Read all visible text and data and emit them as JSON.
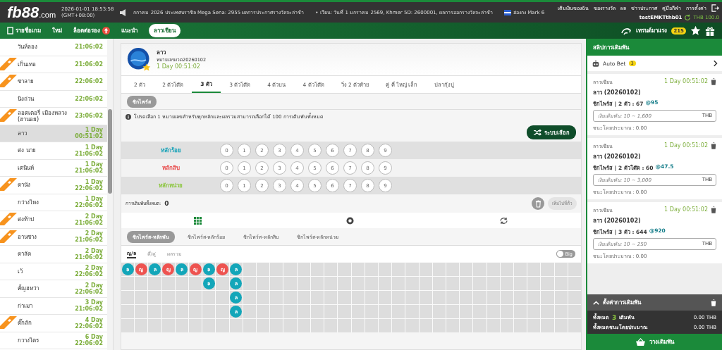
{
  "header": {
    "logo_main": "fb88",
    "logo_suffix": ".com",
    "datetime": "2026-01-01 18:53:58",
    "timezone": "(GMT+08:00)",
    "ticker": [
      "กกาคม 2026 ประเทศบราซิล Mega Sena: 2955 ผลการประกาศรางวัลจะล่าช้า",
      "• เวียน: วันที่ 1 มกราคม 2569, Khmer 5D: 2600001, ผลการออกรางวัลจะล่าช้า",
      "ฮ่องกง Mark 6"
    ],
    "links": [
      "เติมเงินของฉัน",
      "ของรางวัล",
      "ผล",
      "ข่าวประกาศ",
      "คู่มือกีฬา",
      "การตั้งค่า"
    ],
    "username": "testEMKTthb01",
    "balance": "THB 100.0"
  },
  "nav": {
    "items": [
      {
        "label": "รายชื่อเกม",
        "selected": false,
        "kind": "list"
      },
      {
        "label": "ใหม่",
        "selected": false,
        "kind": "plain"
      },
      {
        "label": "ล็อตต่อรอง",
        "selected": false,
        "kind": "hot"
      },
      {
        "label": "แนะนำ",
        "selected": false,
        "kind": "plain"
      },
      {
        "label": "ลาวเชียน",
        "selected": true,
        "kind": "plain"
      }
    ],
    "trending": "เทรนด์มาแรง",
    "trending_count": "215"
  },
  "sidebar": {
    "items": [
      {
        "name": "วันห์ลอง",
        "time": "21:06:02",
        "hot": false,
        "selected": false
      },
      {
        "name": "เก็นเทอ",
        "time": "21:06:02",
        "hot": true,
        "selected": false
      },
      {
        "name": "ซาลาย",
        "time": "22:06:02",
        "hot": true,
        "selected": false
      },
      {
        "name": "นิงถ่วน",
        "time": "22:06:02",
        "hot": false,
        "selected": false
      },
      {
        "name": "ลอตเตอรี่ เมืองหลวง (ฮานอย)",
        "time": "23:06:02",
        "hot": true,
        "selected": false
      },
      {
        "name": "ลาว",
        "day": "1 Day",
        "time": "00:51:02",
        "hot": false,
        "selected": true
      },
      {
        "name": "ด่ง นาย",
        "day": "1 Day",
        "time": "21:06:02",
        "hot": false,
        "selected": false
      },
      {
        "name": "เตนินห์",
        "day": "1 Day",
        "time": "21:06:02",
        "hot": false,
        "selected": false
      },
      {
        "name": "ดานัง",
        "day": "1 Day",
        "time": "22:06:02",
        "hot": true,
        "selected": false
      },
      {
        "name": "กว่างไหง",
        "day": "1 Day",
        "time": "22:06:02",
        "hot": false,
        "selected": false
      },
      {
        "name": "ด่งท้าป",
        "day": "2 Day",
        "time": "21:06:02",
        "hot": true,
        "selected": false
      },
      {
        "name": "อานซาง",
        "day": "2 Day",
        "time": "21:06:02",
        "hot": true,
        "selected": false
      },
      {
        "name": "ดาลัด",
        "day": "2 Day",
        "time": "21:06:02",
        "hot": false,
        "selected": false
      },
      {
        "name": "เว้",
        "day": "2 Day",
        "time": "22:06:02",
        "hot": false,
        "selected": false
      },
      {
        "name": "คั้ญฮหว่า",
        "day": "2 Day",
        "time": "22:06:02",
        "hot": false,
        "selected": false
      },
      {
        "name": "ก่าเมา",
        "day": "3 Day",
        "time": "21:06:02",
        "hot": false,
        "selected": false
      },
      {
        "name": "ดั๊กลัก",
        "day": "4 Day",
        "time": "22:06:02",
        "hot": true,
        "selected": false
      },
      {
        "name": "กวางไตร",
        "day": "6 Day",
        "time": "22:06:02",
        "hot": false,
        "selected": false
      }
    ]
  },
  "game": {
    "title": "ลาว",
    "draw": "หมายเลขงวด20260102",
    "countdown": "1 Day 00:51:02",
    "tabs": [
      {
        "label": "2 ตัว",
        "selected": false
      },
      {
        "label": "2 ตัวโต๊ด",
        "selected": false
      },
      {
        "label": "3 ตัว",
        "selected": true
      },
      {
        "label": "3 ตัวโต๊ด",
        "selected": false
      },
      {
        "label": "4 ตัวบน",
        "selected": false
      },
      {
        "label": "4 ตัวโต๊ด",
        "selected": false
      },
      {
        "label": "วิ่ง 2 ตัวท้าย",
        "selected": false
      },
      {
        "label": "คู่ คี่ ใหญ่ เล็ก",
        "selected": false
      },
      {
        "label": "ปลากุ้งปู",
        "selected": false
      }
    ],
    "subtab": "ชิกไพร์ส",
    "info": "โปรดเลือก 1 หมายเลขสำหรับทุกหลักและผลรวมสามารถเลือกได้ 100 การเดิมพันทั้งหมด",
    "random_button": "ระบบเลือก",
    "digit_rows": [
      {
        "label": "หลักร้อย",
        "color": "#1aa3b8",
        "digits": [
          "0",
          "1",
          "2",
          "3",
          "4",
          "5",
          "6",
          "7",
          "8",
          "9"
        ]
      },
      {
        "label": "หลักสิบ",
        "color": "#e84c4c",
        "digits": [
          "0",
          "1",
          "2",
          "3",
          "4",
          "5",
          "6",
          "7",
          "8",
          "9"
        ]
      },
      {
        "label": "หลักหน่วย",
        "color": "#8cc63f",
        "digits": [
          "0",
          "1",
          "2",
          "3",
          "4",
          "5",
          "6",
          "7",
          "8",
          "9"
        ]
      }
    ],
    "total_label": "การเดิมพันทั้งหมด:",
    "total": "0",
    "add_button": "เพิ่มไปที่ตั๋ว",
    "trend_tabs": [
      {
        "label": "ชิกไพร์ส-หลักพัน",
        "selected": true
      },
      {
        "label": "ชิกไพร์ส-หลักร้อย",
        "selected": false
      },
      {
        "label": "ชิกไพร์ส-หลักสิบ",
        "selected": false
      },
      {
        "label": "ชิกไพร์ส-หลักหน่วย",
        "selected": false
      }
    ],
    "road_tabs": [
      {
        "label": "ญ/ล",
        "selected": true
      },
      {
        "label": "คี่/คู่",
        "selected": false
      },
      {
        "label": "ผลรวม",
        "selected": false
      }
    ],
    "toggle": {
      "label": "Big",
      "on": false
    },
    "road": [
      [
        {
          "label": "ล",
          "color": "#13a6b9"
        }
      ],
      [
        {
          "label": "ญ",
          "color": "#ee5350"
        }
      ],
      [
        {
          "label": "ล",
          "color": "#13a6b9"
        }
      ],
      [
        {
          "label": "ญ",
          "color": "#ee5350"
        }
      ],
      [
        {
          "label": "ล",
          "color": "#13a6b9"
        }
      ],
      [
        {
          "label": "ญ",
          "color": "#ee5350"
        }
      ],
      [
        {
          "label": "ล",
          "color": "#13a6b9"
        },
        {
          "label": "ล",
          "color": "#13a6b9"
        }
      ],
      [
        {
          "label": "ญ",
          "color": "#ee5350"
        }
      ],
      [
        {
          "label": "ล",
          "color": "#13a6b9"
        },
        {
          "label": "ล",
          "color": "#13a6b9"
        },
        {
          "label": "ล",
          "color": "#13a6b9"
        },
        {
          "label": "ล",
          "color": "#13a6b9"
        }
      ]
    ]
  },
  "slip": {
    "title": "สลิปการเดิมพัน",
    "auto_bet": "Auto Bet",
    "auto_bet_count": "3",
    "bets": [
      {
        "label": "ลาวเชียน",
        "countdown": "1 Day 00:51:02",
        "title": "ลาว (20260102)",
        "bet": "ชิกไพร์ส | 2 ตัว : 67",
        "odds": "@95",
        "placeholder": "เงินเดิมพัน: 10 ~ 1,600",
        "currency": "THB",
        "estimate": "ชนะโดยประมาณ : 0.00"
      },
      {
        "label": "ลาวเชียน",
        "countdown": "1 Day 00:51:02",
        "title": "ลาว (20260102)",
        "bet": "ชิกไพร์ส | 2 ตัวโต๊ด : 60",
        "odds": "@47.5",
        "placeholder": "เงินเดิมพัน: 10 ~ 3,000",
        "currency": "THB",
        "estimate": "ชนะโดยประมาณ : 0.00"
      },
      {
        "label": "ลาวเชียน",
        "countdown": "1 Day 00:51:02",
        "title": "ลาว (20260102)",
        "bet": "ชิกไพร์ส | 3 ตัว : 644",
        "odds": "@920",
        "placeholder": "เงินเดิมพัน: 10 ~ 250",
        "currency": "THB",
        "estimate": "ชนะโดยประมาณ : 0.00"
      }
    ],
    "settings": "ตั้งค่าการเดิมพัน",
    "total_label": "ทั้งหมด",
    "total_count": "3",
    "total_suffix": "เดิมพัน",
    "total_amount": "0.00 THB",
    "win_label": "ทั้งหมดชนะโดยประมาณ",
    "win_amount": "0.00 THB",
    "place_button": "วางเดิมพัน"
  }
}
